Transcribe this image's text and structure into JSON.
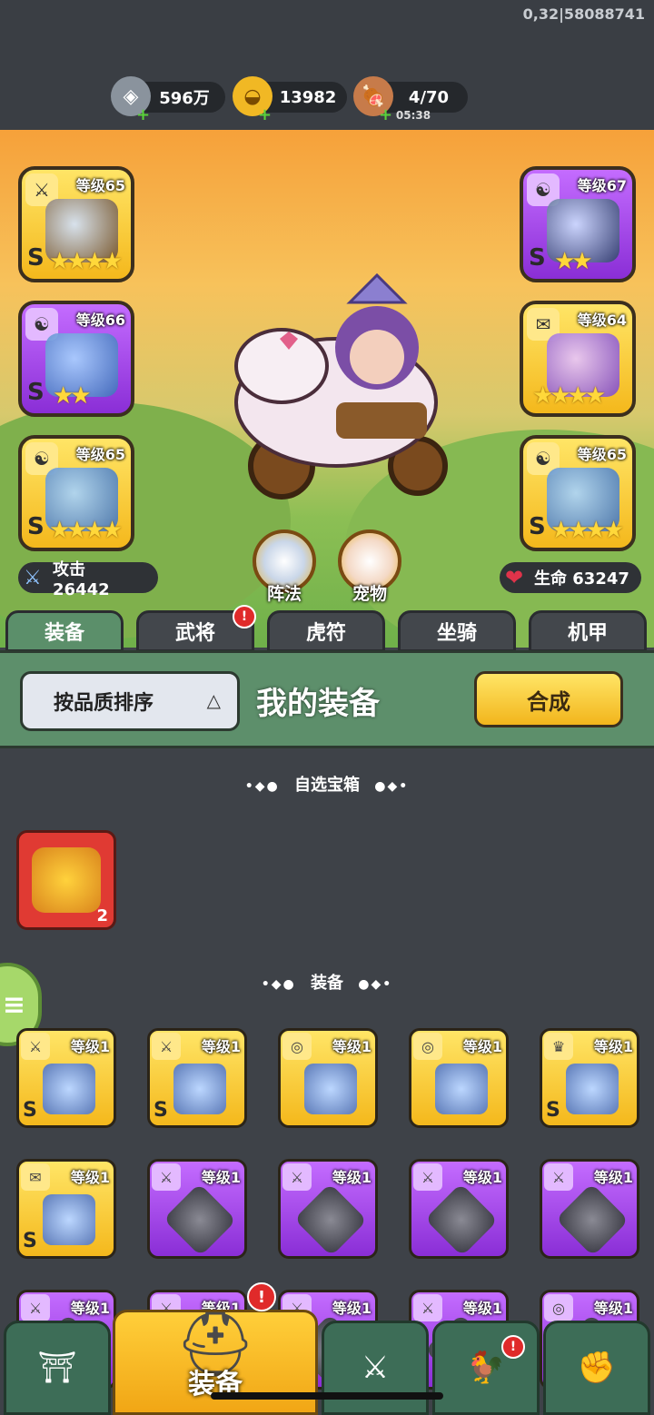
{
  "status": {
    "build": "0,32|58088741"
  },
  "resources": [
    {
      "icon": "silver-coin-icon",
      "value": "596万"
    },
    {
      "icon": "gold-ingot-icon",
      "value": "13982"
    },
    {
      "icon": "meat-stamina-icon",
      "value": "4/70",
      "timer": "05:38"
    }
  ],
  "equip_slots": [
    {
      "level": "等级65",
      "rarity": "gold",
      "tag": "⚔",
      "stars": "★★★★",
      "s": "S"
    },
    {
      "level": "等级66",
      "rarity": "purple",
      "tag": "☯",
      "stars": "★★",
      "s": "S"
    },
    {
      "level": "等级65",
      "rarity": "gold",
      "tag": "☯",
      "stars": "★★★★",
      "s": "S"
    },
    {
      "level": "等级67",
      "rarity": "purple",
      "tag": "☯",
      "stars": "★★",
      "s": "S"
    },
    {
      "level": "等级64",
      "rarity": "gold",
      "tag": "✉",
      "stars": "★★★★",
      "s": ""
    },
    {
      "level": "等级65",
      "rarity": "gold",
      "tag": "☯",
      "stars": "★★★★",
      "s": "S"
    }
  ],
  "stats": {
    "attack": "攻击 26442",
    "hp": "生命 63247"
  },
  "circle_buttons": {
    "formation": "阵法",
    "pet": "宠物"
  },
  "tabs": [
    "装备",
    "武将",
    "虎符",
    "坐骑",
    "机甲"
  ],
  "tab_badge": "!",
  "filter": {
    "sort_label": "按品质排序",
    "sort_arrow": "△",
    "title": "我的装备",
    "merge_label": "合成"
  },
  "sections": {
    "chest_title": "自选宝箱",
    "equip_title": "装备",
    "dots_left": "•◆●",
    "dots_right": "●◆•"
  },
  "chest": {
    "count": "2"
  },
  "items": [
    {
      "level": "等级1",
      "rarity": "gold",
      "tag": "⚔",
      "s": "S"
    },
    {
      "level": "等级1",
      "rarity": "gold",
      "tag": "⚔",
      "s": "S"
    },
    {
      "level": "等级1",
      "rarity": "gold",
      "tag": "◎",
      "s": ""
    },
    {
      "level": "等级1",
      "rarity": "gold",
      "tag": "◎",
      "s": ""
    },
    {
      "level": "等级1",
      "rarity": "gold",
      "tag": "♛",
      "s": "S"
    },
    {
      "level": "等级1",
      "rarity": "gold",
      "tag": "✉",
      "s": "S"
    },
    {
      "level": "等级1",
      "rarity": "purple",
      "tag": "⚔",
      "s": ""
    },
    {
      "level": "等级1",
      "rarity": "purple",
      "tag": "⚔",
      "s": ""
    },
    {
      "level": "等级1",
      "rarity": "purple",
      "tag": "⚔",
      "s": ""
    },
    {
      "level": "等级1",
      "rarity": "purple",
      "tag": "⚔",
      "s": ""
    },
    {
      "level": "等级1",
      "rarity": "purple",
      "tag": "⚔",
      "s": ""
    },
    {
      "level": "等级1",
      "rarity": "purple",
      "tag": "⚔",
      "s": ""
    },
    {
      "level": "等级1",
      "rarity": "purple",
      "tag": "⚔",
      "s": ""
    },
    {
      "level": "等级1",
      "rarity": "purple",
      "tag": "⚔",
      "s": ""
    },
    {
      "level": "等级1",
      "rarity": "purple",
      "tag": "◎",
      "s": ""
    }
  ],
  "side_menu": {
    "icon": "≡"
  },
  "bottom_nav": [
    {
      "icon": "castle-gate-icon",
      "glyph": "⛩",
      "label": ""
    },
    {
      "icon": "helmet-icon",
      "glyph": "⛑",
      "label": "装备",
      "active": true
    },
    {
      "icon": "battle-shield-icon",
      "glyph": "⚔",
      "label": ""
    },
    {
      "icon": "rooster-icon",
      "glyph": "🐓",
      "label": ""
    },
    {
      "icon": "fist-upgrade-icon",
      "glyph": "✊",
      "label": ""
    }
  ],
  "badges": {
    "helmet": "!",
    "rooster": "!"
  }
}
